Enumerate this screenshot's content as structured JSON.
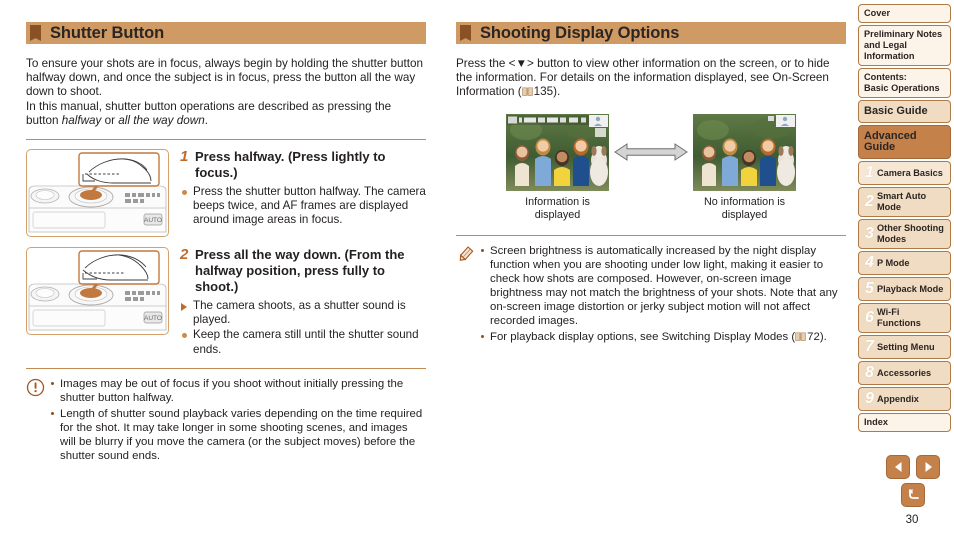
{
  "left": {
    "header": {
      "title": "Shutter Button",
      "flag_color": "#8a5224",
      "bar_color": "#cf9a63"
    },
    "intro_p1": "To ensure your shots are in focus, always begin by holding the shutter button halfway down, and once the subject is in focus, press the button all the way down to shoot.",
    "intro_p2_a": "In this manual, shutter button operations are described as pressing the button ",
    "intro_p2_b": "halfway",
    "intro_p2_c": " or ",
    "intro_p2_d": "all the way down",
    "intro_p2_e": ".",
    "steps": [
      {
        "num": "1",
        "title": "Press halfway. (Press lightly to focus.)",
        "bullets": [
          {
            "kind": "dot",
            "text": "Press the shutter button halfway. The camera beeps twice, and AF frames are displayed around image areas in focus."
          }
        ]
      },
      {
        "num": "2",
        "title": "Press all the way down. (From the halfway position, press fully to shoot.)",
        "bullets": [
          {
            "kind": "tri",
            "text": "The camera shoots, as a shutter sound is played."
          },
          {
            "kind": "dot",
            "text": "Keep the camera still until the shutter sound ends."
          }
        ]
      }
    ],
    "caution": {
      "icon": "exclamation-circle-icon",
      "items": [
        "Images may be out of focus if you shoot without initially pressing the shutter button halfway.",
        "Length of shutter sound playback varies depending on the time required for the shot. It may take longer in some shooting scenes, and images will be blurry if you move the camera (or the subject moves) before the shutter sound ends."
      ]
    }
  },
  "right": {
    "header": {
      "title": "Shooting Display Options"
    },
    "intro_a": "Press the <",
    "intro_b": "> button to view other information on the screen, or to hide the information. For details on the information displayed, see On-Screen Information (",
    "intro_page": "135",
    "intro_c": ").",
    "screens": [
      {
        "caption": "Information is displayed",
        "info_overlay": true
      },
      {
        "caption": "No information is displayed",
        "info_overlay": false
      }
    ],
    "arrow": "double-arrow-icon",
    "note": {
      "icon": "pencil-icon",
      "items": [
        "Screen brightness is automatically increased by the night display function when you are shooting under low light, making it easier to check how shots are composed. However, on-screen image brightness may not match the brightness of your shots. Note that any on-screen image distortion or jerky subject motion will not affect recorded images."
      ],
      "last_item_a": "For playback display options, see Switching Display Modes (",
      "last_item_page": "72",
      "last_item_b": ")."
    }
  },
  "sidebar": {
    "items": [
      {
        "label": "Cover",
        "style": "plain",
        "num": ""
      },
      {
        "label": "Preliminary Notes and Legal Information",
        "style": "plain",
        "num": ""
      },
      {
        "label": "Contents:\nBasic Operations",
        "style": "plain",
        "num": ""
      },
      {
        "label": "Basic Guide",
        "style": "guide",
        "num": ""
      },
      {
        "label": "Advanced Guide",
        "style": "advanced",
        "num": ""
      },
      {
        "label": "Camera Basics",
        "style": "chapter active",
        "num": "1"
      },
      {
        "label": "Smart Auto Mode",
        "style": "chapter",
        "num": "2"
      },
      {
        "label": "Other Shooting Modes",
        "style": "chapter",
        "num": "3"
      },
      {
        "label": "P Mode",
        "style": "chapter",
        "num": "4"
      },
      {
        "label": "Playback Mode",
        "style": "chapter",
        "num": "5"
      },
      {
        "label": "Wi-Fi Functions",
        "style": "chapter",
        "num": "6"
      },
      {
        "label": "Setting Menu",
        "style": "chapter",
        "num": "7"
      },
      {
        "label": "Accessories",
        "style": "chapter",
        "num": "8"
      },
      {
        "label": "Appendix",
        "style": "chapter",
        "num": "9"
      },
      {
        "label": "Index",
        "style": "plain",
        "num": ""
      }
    ]
  },
  "nav": {
    "prev_icon": "left-triangle-icon",
    "next_icon": "right-triangle-icon",
    "back_icon": "return-arrow-icon",
    "page_number": "30"
  }
}
